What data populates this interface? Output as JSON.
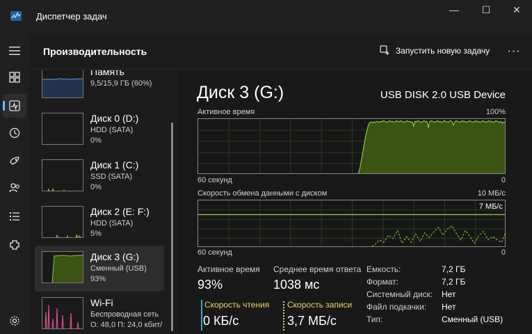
{
  "window": {
    "title": "Диспетчер задач",
    "minimize_glyph": "—",
    "maximize_glyph": "☐",
    "close_glyph": "✕"
  },
  "rail": {
    "menu_icon": "hamburger-icon",
    "items": [
      {
        "icon": "processes-icon"
      },
      {
        "icon": "performance-icon",
        "active": true
      },
      {
        "icon": "history-icon"
      },
      {
        "icon": "startup-icon"
      },
      {
        "icon": "users-icon"
      },
      {
        "icon": "details-icon"
      },
      {
        "icon": "services-icon"
      }
    ],
    "settings_icon": "gear-icon"
  },
  "header": {
    "title": "Производительность",
    "run_task_label": "Запустить новую задачу",
    "more_label": "···"
  },
  "sidebar": {
    "items": [
      {
        "name": "Память",
        "sub1": "9,5/15,9 ГБ (60%)",
        "sub2": ""
      },
      {
        "name": "Диск 0 (D:)",
        "sub1": "HDD (SATA)",
        "sub2": "0%"
      },
      {
        "name": "Диск 1 (C:)",
        "sub1": "SSD (SATA)",
        "sub2": "0%"
      },
      {
        "name": "Диск 2 (E: F:)",
        "sub1": "HDD (SATA)",
        "sub2": "5%"
      },
      {
        "name": "Диск 3 (G:)",
        "sub1": "Сменный (USB)",
        "sub2": "93%",
        "selected": true
      },
      {
        "name": "Wi-Fi",
        "sub1": "Беспроводная сеть",
        "sub2": "О: 48,0 П: 24,0 кбит/"
      }
    ]
  },
  "main": {
    "title": "Диск 3 (G:)",
    "model": "USB DISK 2.0 USB Device",
    "active_graph": {
      "label": "Активное время",
      "max_label": "100%",
      "time_label": "60 секунд",
      "min_label": "0",
      "values": [
        0,
        0,
        0,
        0,
        0,
        0,
        0,
        0,
        0,
        0,
        0,
        0,
        0,
        0,
        0,
        0,
        0,
        0,
        0,
        0,
        0,
        0,
        0,
        0,
        0,
        0,
        0,
        0,
        0,
        0,
        0,
        0,
        0,
        0,
        0,
        0,
        0,
        0,
        0,
        0,
        0,
        0,
        0,
        0,
        0,
        0,
        0,
        0,
        0,
        0,
        0,
        0,
        0,
        0,
        0,
        0,
        0,
        0,
        0,
        0,
        0,
        0,
        0,
        0,
        0,
        0,
        0,
        0,
        0,
        0,
        0,
        0,
        0,
        0,
        0,
        0,
        0,
        0,
        0,
        0,
        0,
        0,
        0,
        0,
        0,
        0,
        0,
        0,
        0,
        0,
        0,
        0,
        0,
        0,
        0,
        0,
        0,
        0,
        0,
        0,
        0,
        0,
        0,
        0,
        0,
        0,
        0,
        0,
        0,
        0,
        0,
        0,
        0,
        0,
        0,
        0,
        0,
        0,
        0,
        0,
        0,
        0,
        8,
        20,
        34,
        48,
        62,
        74,
        84,
        92,
        95,
        96,
        94,
        96,
        95,
        97,
        96,
        95,
        97,
        96,
        98,
        97,
        96,
        95,
        97,
        98,
        96,
        97,
        95,
        96,
        98,
        97,
        96,
        98,
        97,
        96,
        95,
        97,
        98,
        96,
        97,
        95,
        96,
        88,
        97,
        96,
        98,
        97,
        96,
        95,
        97,
        98,
        96,
        97,
        85,
        96,
        98,
        97,
        96,
        95,
        97,
        98,
        96,
        97,
        95,
        96,
        98,
        97,
        96,
        95,
        97,
        98,
        96,
        90,
        96,
        98,
        97,
        96,
        95,
        97,
        98,
        96,
        97,
        95,
        96,
        98,
        97,
        96,
        95,
        97,
        98,
        96,
        97,
        95,
        96,
        98,
        97,
        96,
        95,
        97,
        98,
        96,
        97,
        95,
        96,
        98,
        97,
        96,
        95,
        97,
        93,
        96,
        95,
        96
      ]
    },
    "transfer_graph": {
      "label": "Скорость обмена данными с диском",
      "max_label": "10 МБ/с",
      "line_label": "7 МБ/с",
      "line_value": 7,
      "max_value": 10,
      "time_label": "60 секунд",
      "min_label": "0",
      "read_values": [
        0,
        0,
        0,
        0,
        0,
        0,
        0,
        0,
        0,
        0,
        0,
        0,
        0,
        0,
        0,
        0,
        0,
        0,
        0,
        0,
        0,
        0,
        0,
        0,
        0,
        0,
        0,
        0,
        0,
        0,
        0,
        0,
        0,
        0,
        0,
        0,
        0,
        0,
        0,
        0,
        0,
        0,
        0,
        0,
        0,
        0,
        0,
        0,
        0,
        0,
        0,
        0,
        0,
        0,
        0,
        0,
        0,
        0,
        0,
        0
      ],
      "write_values": [
        0,
        0,
        0,
        0,
        0,
        0,
        0,
        0,
        0,
        0,
        0,
        0,
        0,
        0,
        0,
        0,
        0,
        0,
        0,
        0,
        0,
        0,
        0,
        0,
        0,
        0,
        0,
        0,
        0,
        0,
        0,
        0,
        0,
        0,
        0,
        0,
        0,
        0,
        0,
        0.5,
        1.5,
        1,
        2.5,
        1.8,
        3.5,
        0.8,
        2.2,
        1,
        2.8,
        1.2,
        3,
        2,
        3.2,
        4.2,
        2.5,
        3.8,
        4.5,
        2.8,
        1.5,
        3.5,
        2.2,
        0.8,
        2.5,
        3.3,
        1.5,
        2.2,
        1.5,
        1,
        3.5
      ]
    },
    "stats": {
      "active_time_label": "Активное время",
      "active_time_value": "93%",
      "avg_response_label": "Среднее время ответа",
      "avg_response_value": "1038 мс",
      "read_speed_label": "Скорость чтения",
      "read_speed_value": "0 КБ/с",
      "write_speed_label": "Скорость записи",
      "write_speed_value": "3,7 МБ/с"
    },
    "info": [
      {
        "key": "Емкость:",
        "value": "7,2 ГБ"
      },
      {
        "key": "Формат:",
        "value": "7,2 ГБ"
      },
      {
        "key": "Системный диск:",
        "value": "Нет"
      },
      {
        "key": "Файл подкачки:",
        "value": "Нет"
      },
      {
        "key": "Тип:",
        "value": "Сменный (USB)"
      }
    ],
    "colors": {
      "accent": "#6cc0ff",
      "disk_line": "#8cc43c",
      "disk_fill": "#3b5313",
      "grid": "#2e3a22",
      "read_accent": "#3aa6c4",
      "write_accent": "#e8d46a"
    }
  }
}
